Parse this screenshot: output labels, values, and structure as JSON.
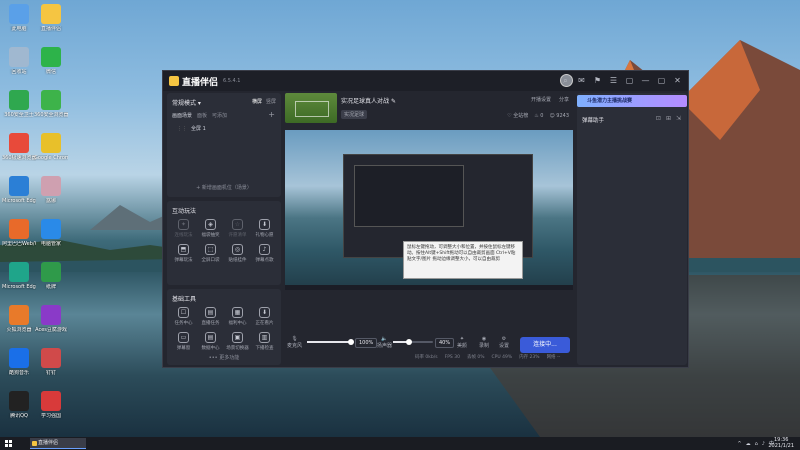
{
  "desktop": {
    "icons": [
      {
        "label": "此电脑",
        "color": "#5aa0e8"
      },
      {
        "label": "回收站",
        "color": "#a0b8d0"
      },
      {
        "label": "360安全卫士",
        "color": "#2fa84f"
      },
      {
        "label": "360极速浏览器",
        "color": "#e84a3a"
      },
      {
        "label": "Microsoft Edge Dev",
        "color": "#2b7fd6"
      },
      {
        "label": "阿里巴巴Web/Win",
        "color": "#e86a2a"
      },
      {
        "label": "Microsoft Edge",
        "color": "#1fa58a"
      },
      {
        "label": "火狐浏览器",
        "color": "#e87a2a"
      },
      {
        "label": "酷狗音乐",
        "color": "#1a6fe8"
      },
      {
        "label": "腾讯QQ",
        "color": "#222222"
      },
      {
        "label": "直播伴侣",
        "color": "#f5c542"
      },
      {
        "label": "微信",
        "color": "#2db34a"
      },
      {
        "label": "360安全浏览器",
        "color": "#3db34a"
      },
      {
        "label": "Google Chrome",
        "color": "#e8c02a"
      },
      {
        "label": "露娜",
        "color": "#cfa0b0"
      },
      {
        "label": "电脑管家",
        "color": "#2a8ae8"
      },
      {
        "label": "纸牌",
        "color": "#2f9a4a"
      },
      {
        "label": "Aces豆腐游戏",
        "color": "#8a3ac8"
      },
      {
        "label": "钉钉",
        "color": "#d04a4a"
      },
      {
        "label": "学习强国",
        "color": "#d83a3a"
      }
    ]
  },
  "app": {
    "name": "直播伴侣",
    "version": "6.5.4.1",
    "window_controls": [
      "⌕",
      "✉",
      "⚑",
      "☰",
      "▢",
      "—",
      "▢",
      "✕"
    ]
  },
  "left": {
    "scene_panel": {
      "title": "常规模式 ▾",
      "tabs": [
        "横屏",
        "竖屏"
      ],
      "subtabs": [
        "画面场景",
        "面板",
        "可添加"
      ],
      "scene_item": "全屏 1",
      "new_scene": "+ 新增画面机位（场景）"
    },
    "interaction_panel": {
      "title": "互动玩法",
      "items": [
        {
          "label": "连线玩法",
          "icon": "✦",
          "dim": true
        },
        {
          "label": "福袋抽奖",
          "icon": "◈",
          "dim": false
        },
        {
          "label": "许愿清单",
          "icon": "☆",
          "dim": true
        },
        {
          "label": "礼物心愿",
          "icon": "⬇",
          "dim": false
        },
        {
          "label": "弹幕玩法",
          "icon": "⬒",
          "dim": false
        },
        {
          "label": "全屏口袋",
          "icon": "⬚",
          "dim": false
        },
        {
          "label": "贴纸挂件",
          "icon": "◎",
          "dim": false
        },
        {
          "label": "弹幕点歌",
          "icon": "♪",
          "dim": false
        }
      ]
    },
    "tools_panel": {
      "title": "基础工具",
      "items": [
        {
          "label": "任务中心",
          "icon": "☐",
          "dim": false
        },
        {
          "label": "直播任务",
          "icon": "▤",
          "dim": false
        },
        {
          "label": "福利中心",
          "icon": "▦",
          "dim": false
        },
        {
          "label": "正在看片",
          "icon": "⬇",
          "dim": false
        },
        {
          "label": "弹幕窗",
          "icon": "▭",
          "dim": false
        },
        {
          "label": "数据中心",
          "icon": "▤",
          "dim": false
        },
        {
          "label": "场景切换器",
          "icon": "▣",
          "dim": false
        },
        {
          "label": "下播检查",
          "icon": "▥",
          "dim": false
        }
      ],
      "more": "••• 更多功能"
    }
  },
  "center": {
    "room_title": "实况足球真人对战",
    "tag_button": "实况足球",
    "actions": [
      "开播设置",
      "分享"
    ],
    "stats": [
      "♡ 全站榜",
      "♨ 0",
      "☺ 9243"
    ],
    "tooltip": "鼠标左键拖动，可调整大小和位置，并按住鼠标左键移动。按住Alt键+Shift拖动可以自由裁剪画面 Ctrl+V粘贴文字/图片 拖动边缘调整大小，可以自由裁剪",
    "controls": {
      "mic_label": "麦克风",
      "mic_value": "100%",
      "mic_level": 1.0,
      "speaker_label": "扬声器",
      "speaker_value": "40%",
      "speaker_level": 0.4,
      "beauty": "美颜",
      "record": "录制",
      "settings": "设置",
      "start": "连接中..."
    },
    "status": [
      "码率 0kb/s",
      "FPS 30",
      "丢帧 0%",
      "CPU 49%",
      "内存 23%",
      "网络 --"
    ]
  },
  "right": {
    "banner": "斗鱼潜力主播挑战赛",
    "title": "弹幕助手",
    "icons": [
      "⊡",
      "⊞",
      "⇲"
    ]
  },
  "taskbar": {
    "app_label": "直播伴侣",
    "tray": [
      "^",
      "☁",
      "⌂",
      "♪",
      "中"
    ],
    "time": "19:36",
    "date": "2021/1/21"
  }
}
